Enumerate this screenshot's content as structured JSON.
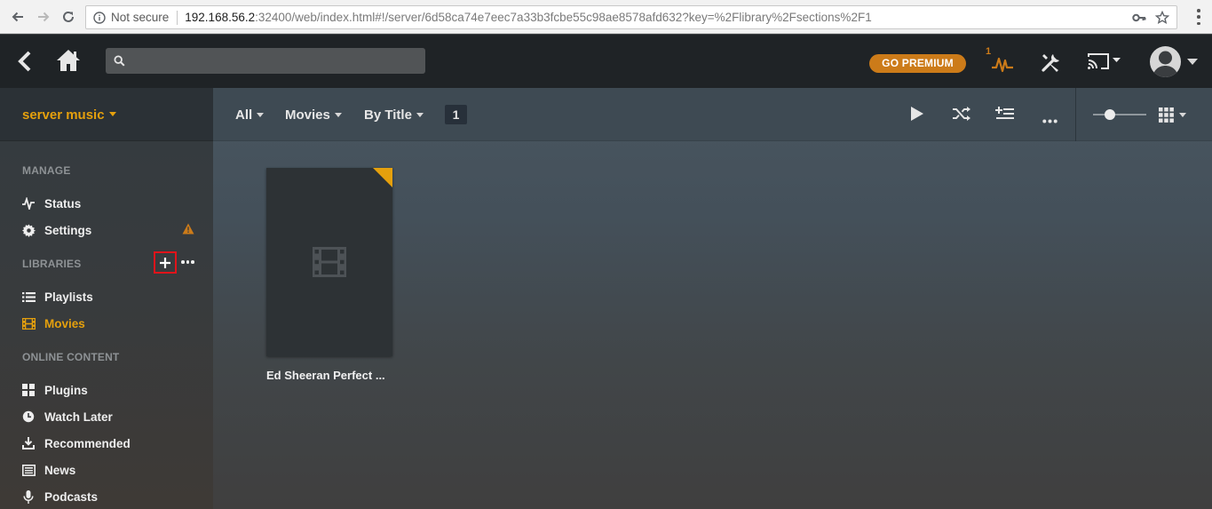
{
  "browser": {
    "not_secure": "Not secure",
    "url_host": "192.168.56.2",
    "url_rest": ":32400/web/index.html#!/server/6d58ca74e7eec7a33b3fcbe55c98ae8578afd632?key=%2Flibrary%2Fsections%2F1"
  },
  "topbar": {
    "search_placeholder": "",
    "premium_label": "GO PREMIUM",
    "activity_count": "1",
    "accent": "#cc7b19"
  },
  "sidebar": {
    "library_name": "server music",
    "manage_label": "MANAGE",
    "manage_items": [
      {
        "label": "Status",
        "icon": "activity-icon"
      },
      {
        "label": "Settings",
        "icon": "gear-icon"
      }
    ],
    "libraries_label": "LIBRARIES",
    "library_items": [
      {
        "label": "Playlists",
        "icon": "list-icon"
      },
      {
        "label": "Movies",
        "icon": "film-icon",
        "active": true
      }
    ],
    "online_label": "ONLINE CONTENT",
    "online_items": [
      {
        "label": "Plugins",
        "icon": "grid-icon"
      },
      {
        "label": "Watch Later",
        "icon": "clock-icon"
      },
      {
        "label": "Recommended",
        "icon": "download-icon"
      },
      {
        "label": "News",
        "icon": "news-icon"
      },
      {
        "label": "Podcasts",
        "icon": "microphone-icon"
      }
    ],
    "active_color": "#e5a00d"
  },
  "toolbar": {
    "filter_all": "All",
    "filter_type": "Movies",
    "filter_sort": "By Title",
    "count": "1"
  },
  "content": {
    "items": [
      {
        "title": "Ed Sheeran Perfect ..."
      }
    ]
  }
}
